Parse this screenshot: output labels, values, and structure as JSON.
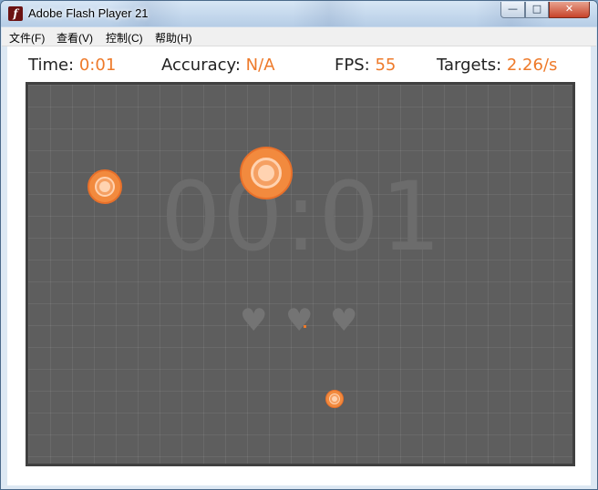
{
  "window": {
    "title": "Adobe Flash Player 21",
    "app_icon_glyph": "f",
    "minimize_glyph": "—",
    "maximize_glyph": "□",
    "close_glyph": "✕"
  },
  "menu": {
    "items": [
      "文件(F)",
      "查看(V)",
      "控制(C)",
      "帮助(H)"
    ]
  },
  "hud": {
    "time_label": "Time:",
    "time_value": "0:01",
    "accuracy_label": "Accuracy:",
    "accuracy_value": "N/A",
    "fps_label": "FPS:",
    "fps_value": "55",
    "targets_label": "Targets:",
    "targets_value": "2.26/s"
  },
  "game": {
    "big_timer": "00:01",
    "lives": [
      "♥",
      "♥",
      "♥"
    ],
    "accent_color": "#ee7a2a",
    "arena_color": "#5e5e5e"
  }
}
